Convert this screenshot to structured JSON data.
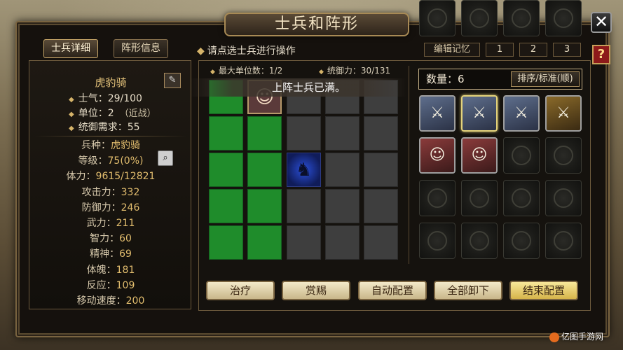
{
  "title": "士兵和阵形",
  "tabs": [
    {
      "label": "士兵详细",
      "active": true
    },
    {
      "label": "阵形信息",
      "active": false
    }
  ],
  "hint": "请点选士兵进行操作",
  "memory": {
    "label": "编辑记忆",
    "slots": [
      "1",
      "2",
      "3"
    ]
  },
  "close_glyph": "✕",
  "help_glyph": "?",
  "unit": {
    "name": "虎豹骑",
    "morale": "士气：29/100",
    "units": "单位：2",
    "units_type": "（近战）",
    "command_req": "统御需求：55"
  },
  "attributes": [
    {
      "k": "兵种：",
      "v": "虎豹骑"
    },
    {
      "k": "等级：",
      "v": "75(0%)"
    },
    {
      "k": "体力：",
      "v": "9615/12821"
    },
    {
      "k": "攻击力：",
      "v": "332"
    },
    {
      "k": "防御力：",
      "v": "246"
    },
    {
      "k": "武力：",
      "v": "211"
    },
    {
      "k": "智力：",
      "v": "60"
    },
    {
      "k": "精神：",
      "v": "69"
    },
    {
      "k": "体魄：",
      "v": "181"
    },
    {
      "k": "反应：",
      "v": "109"
    },
    {
      "k": "移动速度：",
      "v": "200"
    }
  ],
  "formation": {
    "max_units": "最大单位数：1/2",
    "command": "统御力：30/131",
    "toast": "上阵士兵已满。"
  },
  "roster": {
    "count_label": "数量：6",
    "sort_label": "排序/标准(顺)",
    "units": [
      {
        "type": "spearman"
      },
      {
        "type": "spearman",
        "selected": true
      },
      {
        "type": "spearman"
      },
      {
        "type": "swordsman"
      },
      {
        "type": "archer"
      },
      {
        "type": "archer"
      }
    ],
    "empty_slots": 14
  },
  "buttons": [
    "治疗",
    "赏赐",
    "自动配置",
    "全部卸下",
    "结束配置"
  ],
  "watermark": "亿图手游网"
}
